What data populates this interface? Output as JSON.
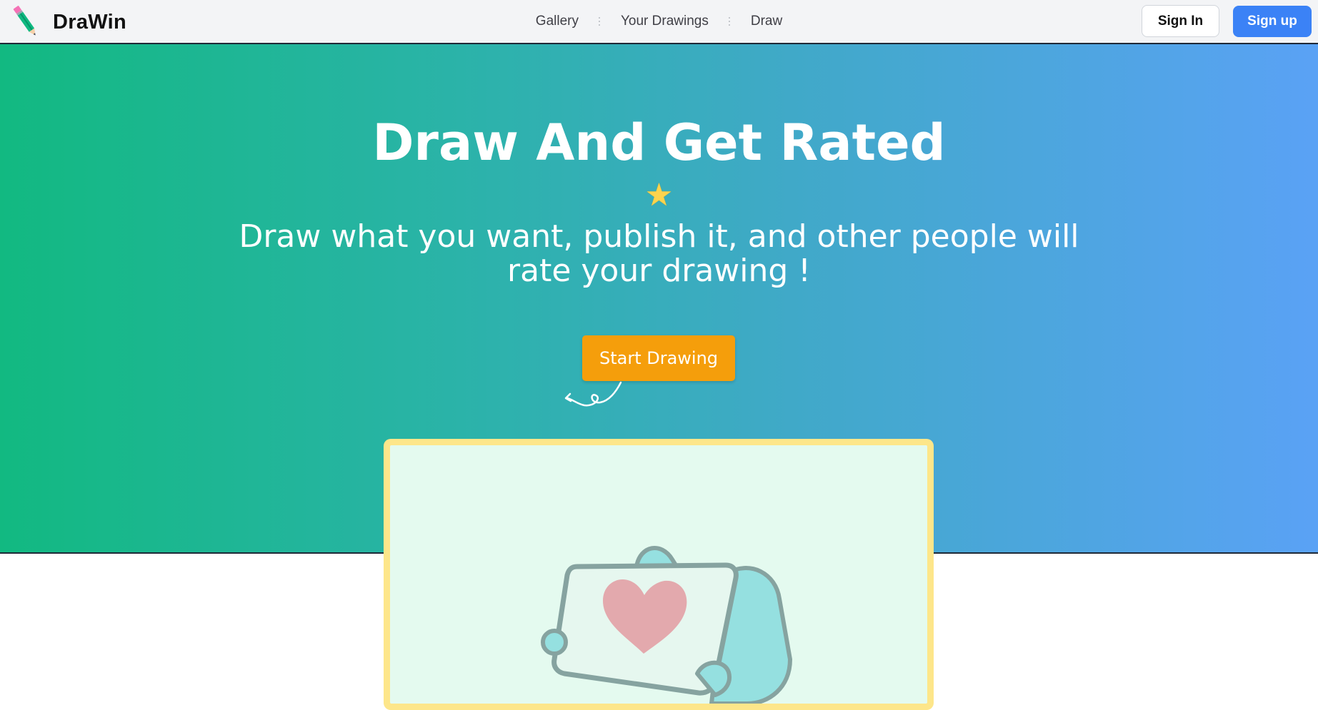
{
  "brand": {
    "name": "DraWin",
    "logo_icon": "pencil-icon"
  },
  "nav": {
    "links": [
      {
        "label": "Gallery"
      },
      {
        "label": "Your Drawings"
      },
      {
        "label": "Draw"
      }
    ]
  },
  "auth": {
    "signin_label": "Sign In",
    "signup_label": "Sign up"
  },
  "hero": {
    "title": "Draw And Get Rated",
    "star_icon": "star-icon",
    "star_glyph": "★",
    "subtitle": "Draw what you want, publish it, and other people will rate your drawing !",
    "cta_label": "Start Drawing"
  },
  "showcase": {
    "illustration_icon": "heart-card-hand-icon"
  },
  "colors": {
    "hero_gradient_start": "#12b981",
    "hero_gradient_end": "#5aa2f5",
    "cta": "#f59e0b",
    "signup": "#3b82f6",
    "card_border": "#fde68a",
    "card_bg": "#e4faef",
    "heart": "#e3a9ad",
    "hand": "#95e0e0"
  }
}
